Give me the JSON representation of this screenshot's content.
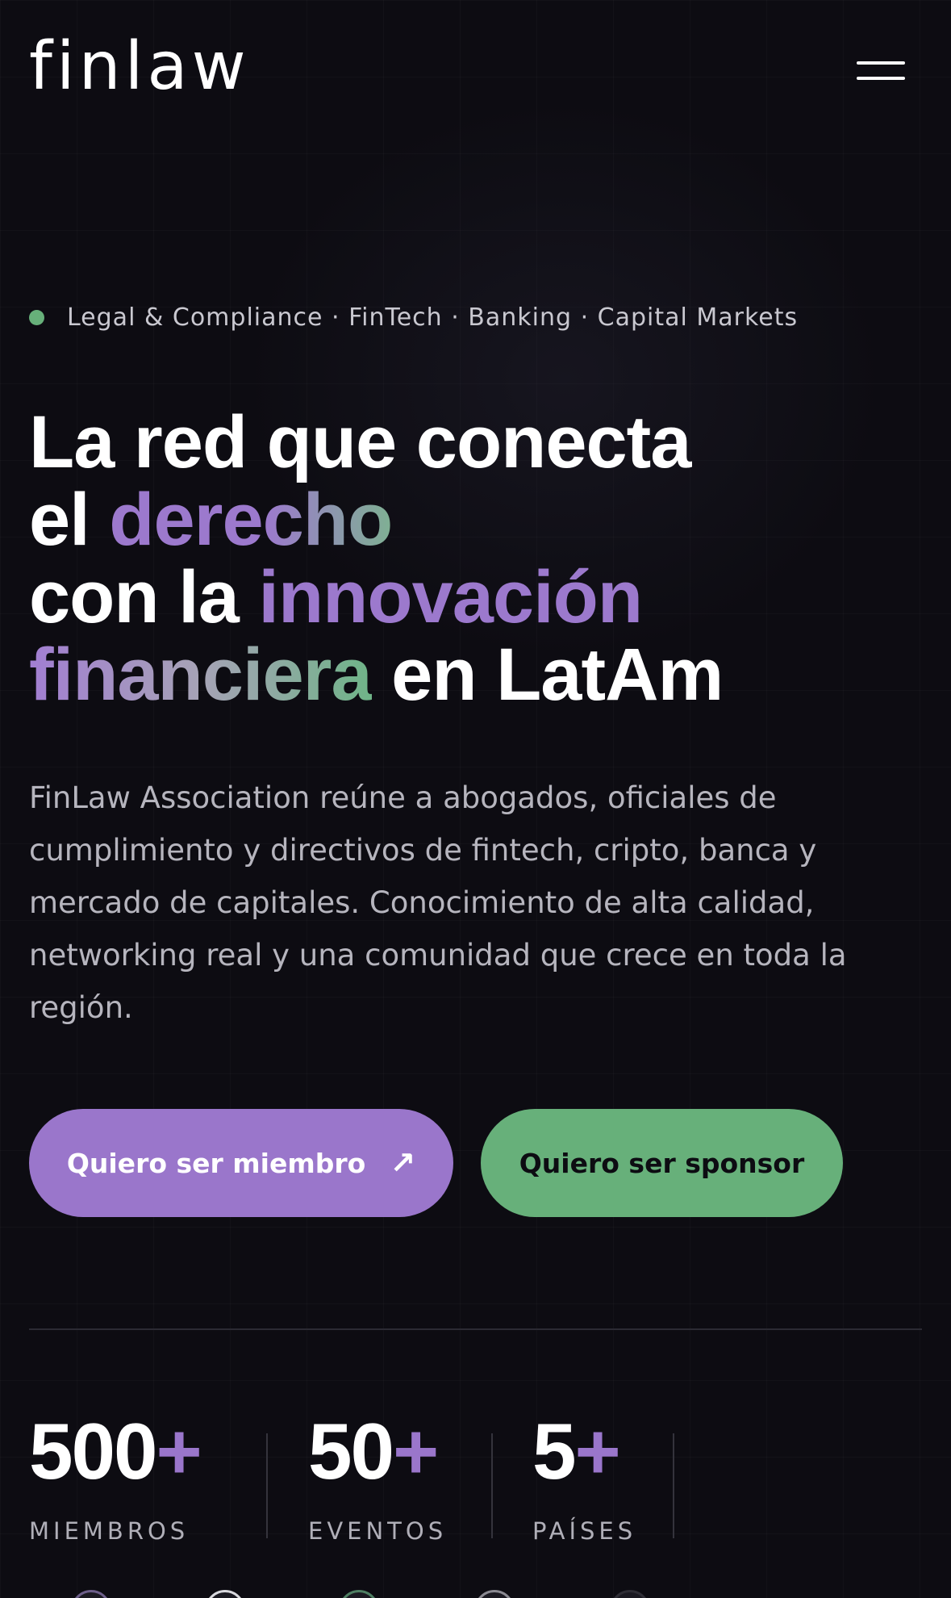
{
  "header": {
    "logo_text": "finlaw",
    "menu_icon": "hamburger-menu-icon"
  },
  "hero": {
    "tagline": "Legal & Compliance · FinTech · Banking · Capital Markets",
    "headline": {
      "line1": "La red que conecta",
      "line2_prefix": "el ",
      "line2_accent": "derecho",
      "line3_prefix": "con la ",
      "line3_accent": "innovación",
      "line4_accent": "financiera",
      "line4_suffix": " en LatAm"
    },
    "description": "FinLaw Association reúne a abogados, oficiales de cumplimiento y directivos de fintech, cripto, banca y mercado de capitales. Conocimiento de alta calidad, networking real y una comunidad que crece en toda la región.",
    "cta_member": {
      "label": "Quiero ser miembro",
      "icon": "arrow-up-right-icon",
      "glyph": "↗"
    },
    "cta_sponsor": {
      "label": "Quiero ser sponsor"
    }
  },
  "stats": [
    {
      "value": "500",
      "suffix": "+",
      "label": "MIEMBROS"
    },
    {
      "value": "50",
      "suffix": "+",
      "label": "EVENTOS"
    },
    {
      "value": "5",
      "suffix": "+",
      "label": "PAÍSES"
    }
  ],
  "colors": {
    "background": "#0d0c12",
    "accent_purple": "#9a76cb",
    "accent_green": "#67b07a",
    "text_primary": "#ffffff",
    "text_muted": "#b6b5be"
  }
}
